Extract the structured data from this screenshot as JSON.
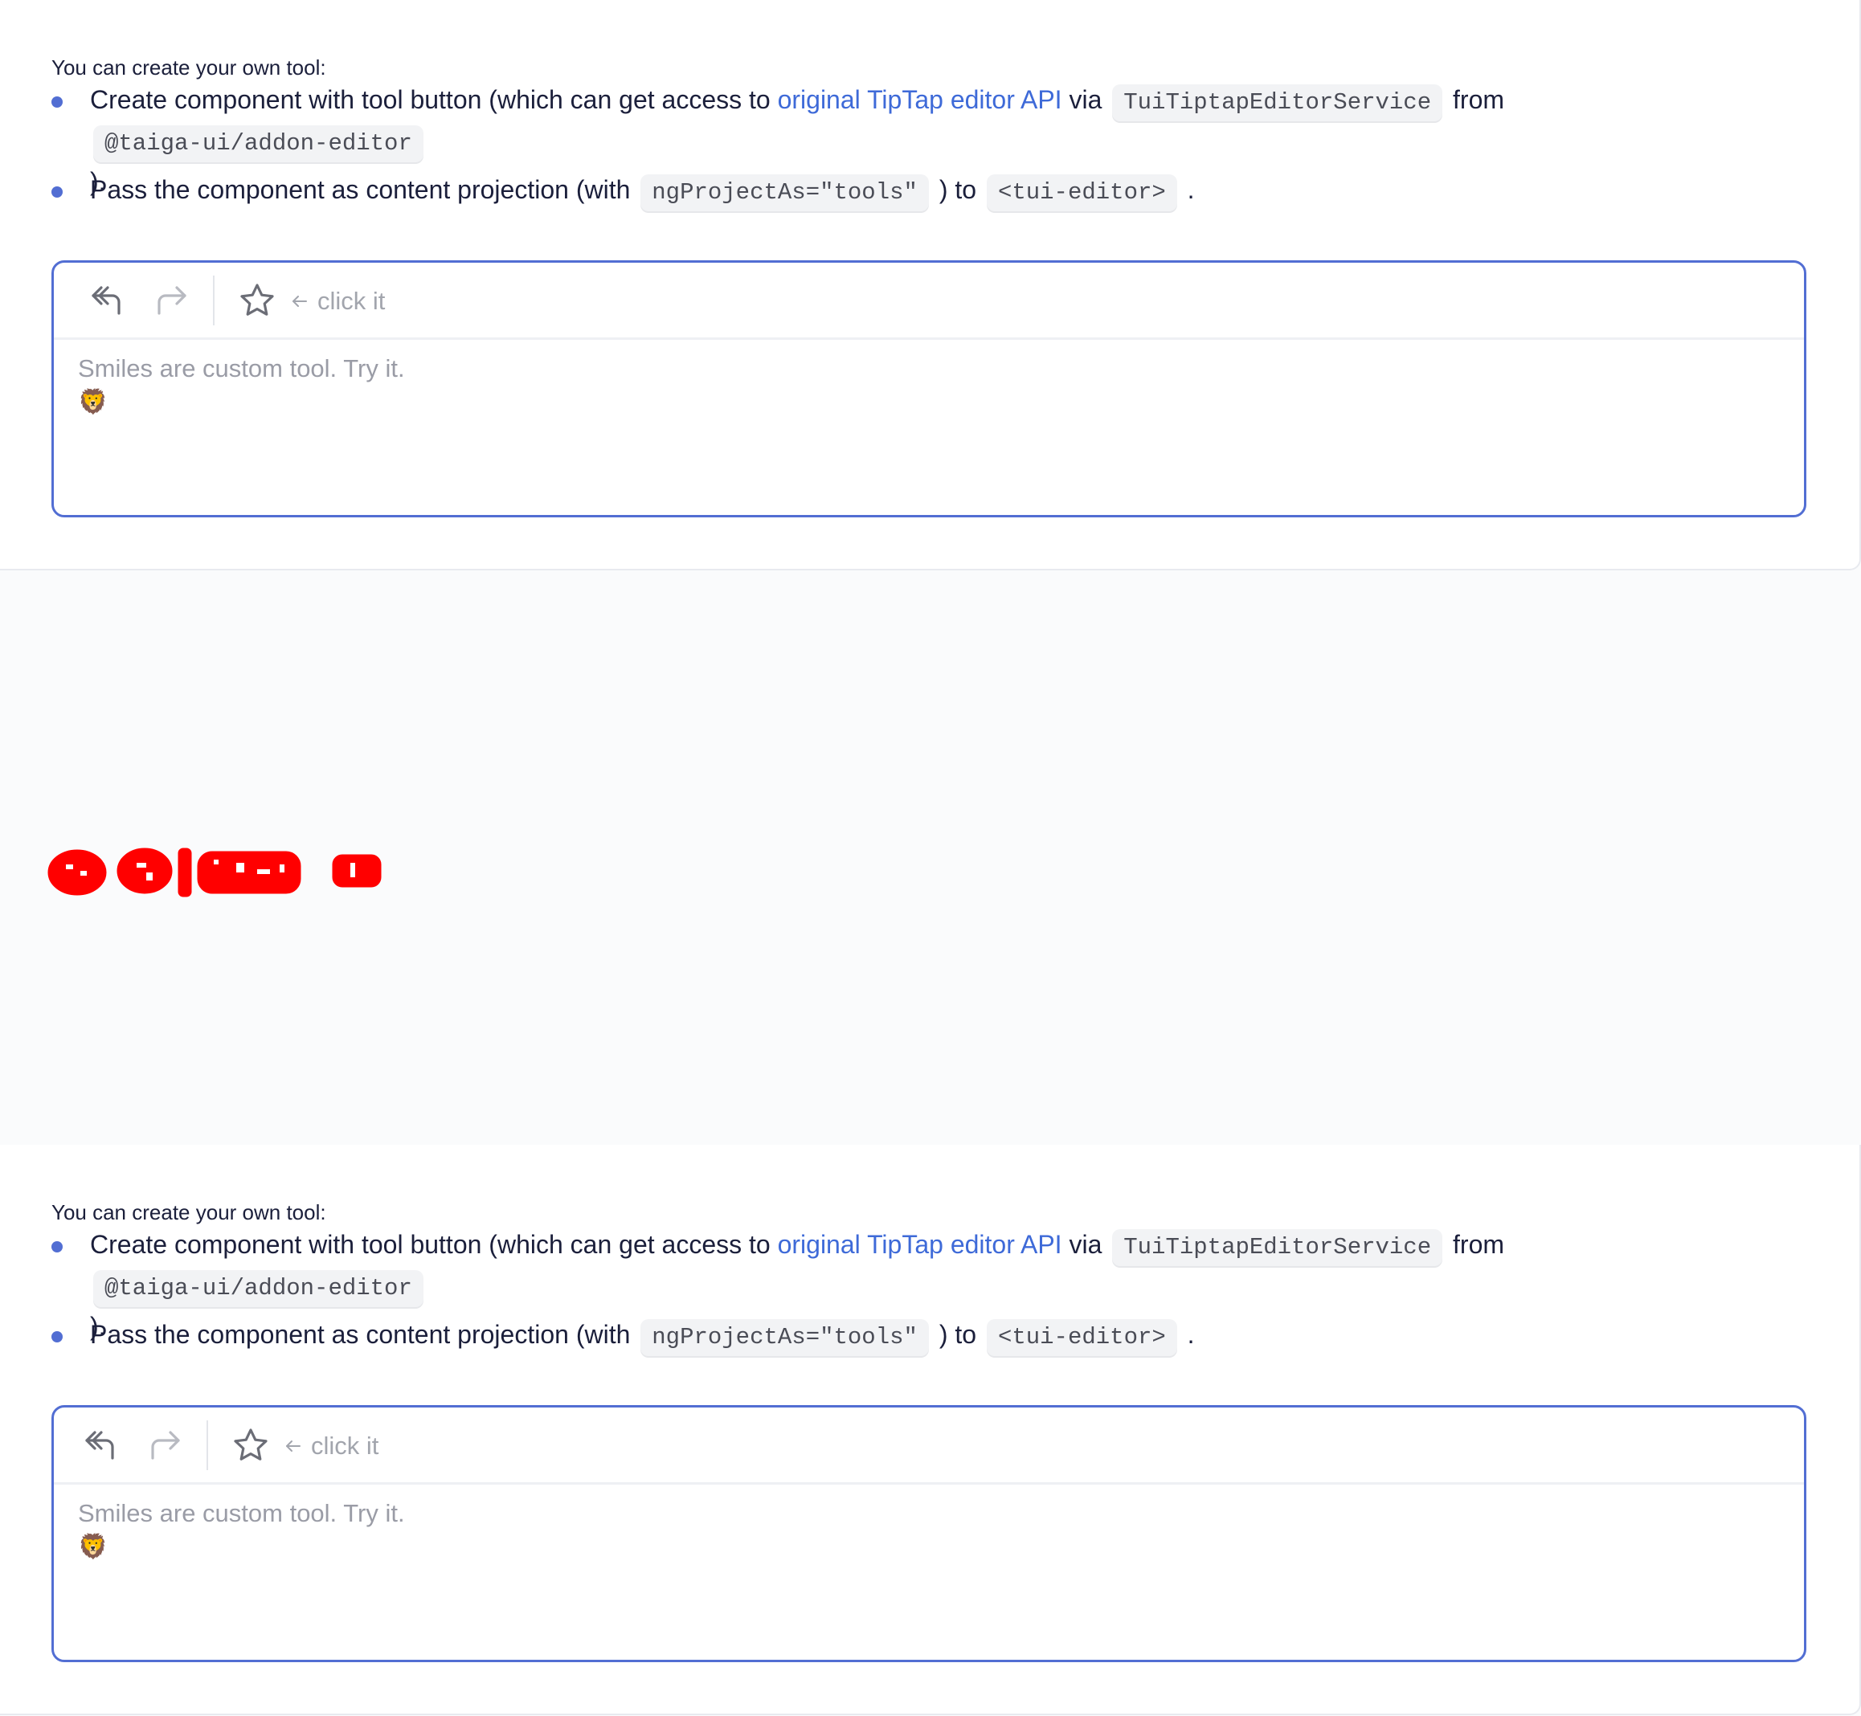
{
  "sections": [
    {
      "intro": "You can create your own tool:",
      "bullet1": {
        "before_link": "Create component with tool button (which can get access to ",
        "link": "original TipTap editor API",
        "after_link": " via ",
        "code1": "TuiTiptapEditorService",
        "middle": " from ",
        "code2": "@taiga-ui/addon-editor",
        "end": " )."
      },
      "bullet2": {
        "before": "Pass the component as content projection (with ",
        "code1": "ngProjectAs=\"tools\"",
        "middle": " ) to ",
        "code2": "<tui-editor>",
        "end": " ."
      },
      "editor": {
        "hint": "click it",
        "content": "Smiles are custom tool. Try it.",
        "emoji": "🦁"
      }
    },
    {
      "intro": "You can create your own tool:",
      "bullet1": {
        "before_link": "Create component with tool button (which can get access to ",
        "link": "original TipTap editor API",
        "after_link": " via ",
        "code1": "TuiTiptapEditorService",
        "middle": " from ",
        "code2": "@taiga-ui/addon-editor",
        "end": " )."
      },
      "bullet2": {
        "before": "Pass the component as content projection (with ",
        "code1": "ngProjectAs=\"tools\"",
        "middle": " ) to ",
        "code2": "<tui-editor>",
        "end": " ."
      },
      "editor": {
        "hint": "click it",
        "content": "Smiles are custom tool. Try it.",
        "emoji": "🦁"
      }
    }
  ],
  "colors": {
    "accent": "#526ed3",
    "link": "#3e6ad8",
    "annotation": "#ff0000"
  },
  "icons": [
    "undo-icon",
    "redo-icon",
    "star-icon",
    "arrow-left-icon"
  ]
}
